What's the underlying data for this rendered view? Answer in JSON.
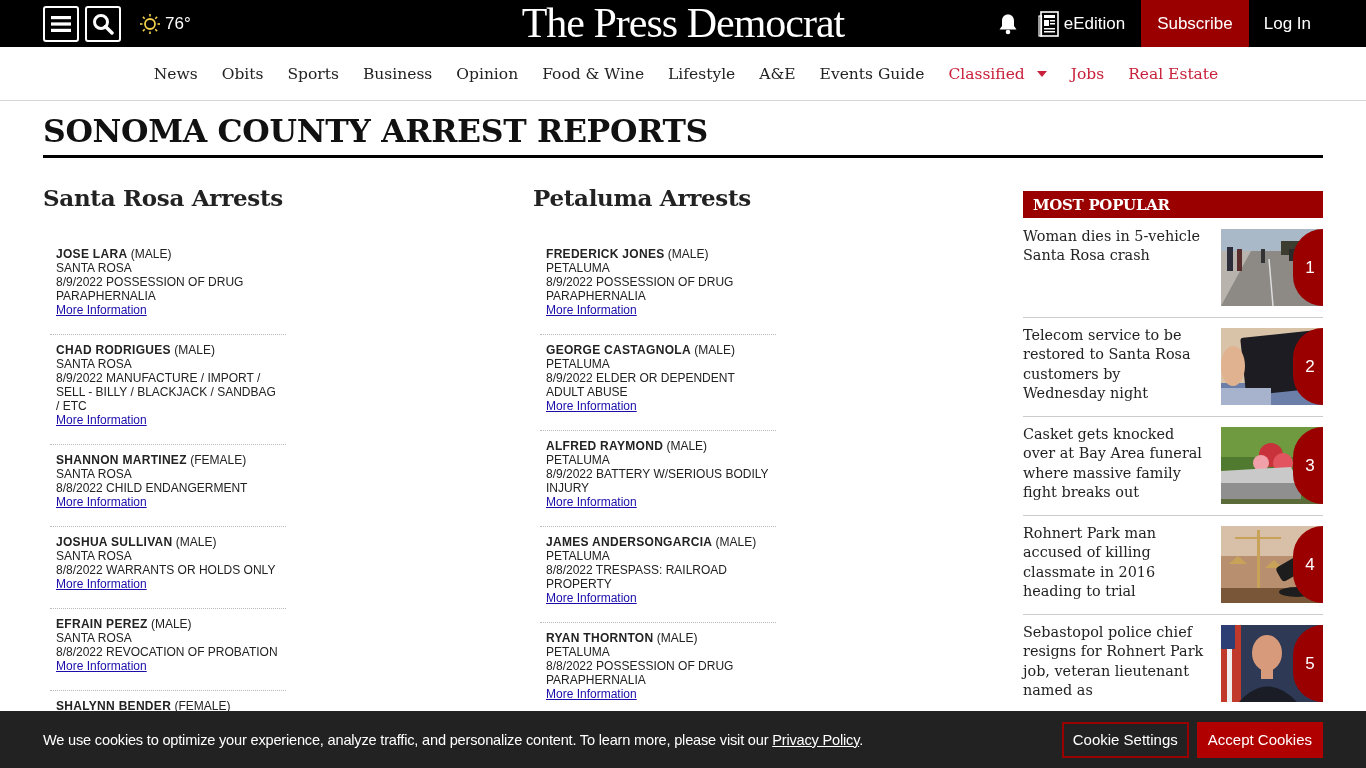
{
  "header": {
    "weather": "76°",
    "logo": "The Press Democrat",
    "edition": "eEdition",
    "subscribe": "Subscribe",
    "login": "Log In"
  },
  "nav": [
    {
      "label": "News",
      "kind": "section",
      "dropdown": false
    },
    {
      "label": "Obits",
      "kind": "section",
      "dropdown": false
    },
    {
      "label": "Sports",
      "kind": "section",
      "dropdown": false
    },
    {
      "label": "Business",
      "kind": "section",
      "dropdown": false
    },
    {
      "label": "Opinion",
      "kind": "section",
      "dropdown": false
    },
    {
      "label": "Food & Wine",
      "kind": "section",
      "dropdown": false
    },
    {
      "label": "Lifestyle",
      "kind": "section",
      "dropdown": false
    },
    {
      "label": "A&E",
      "kind": "section",
      "dropdown": false
    },
    {
      "label": "Events Guide",
      "kind": "section",
      "dropdown": false
    },
    {
      "label": "Classified",
      "kind": "promo",
      "dropdown": true
    },
    {
      "label": "Jobs",
      "kind": "promo",
      "dropdown": false
    },
    {
      "label": "Real Estate",
      "kind": "promo",
      "dropdown": false
    }
  ],
  "page_title": "SONOMA COUNTY ARREST REPORTS",
  "columns": [
    {
      "title": "Santa Rosa Arrests",
      "arrests": [
        {
          "name": "JOSE LARA",
          "gender": "(MALE)",
          "city": "SANTA ROSA",
          "charge": "8/9/2022 POSSESSION OF DRUG PARAPHERNALIA",
          "link": "More Information"
        },
        {
          "name": "CHAD RODRIGUES",
          "gender": "(MALE)",
          "city": "SANTA ROSA",
          "charge": "8/9/2022 MANUFACTURE / IMPORT / SELL - BILLY / BLACKJACK / SANDBAG / ETC",
          "link": "More Information"
        },
        {
          "name": "SHANNON MARTINEZ",
          "gender": "(FEMALE)",
          "city": "SANTA ROSA",
          "charge": "8/8/2022 CHILD ENDANGERMENT",
          "link": "More Information"
        },
        {
          "name": "JOSHUA SULLIVAN",
          "gender": "(MALE)",
          "city": "SANTA ROSA",
          "charge": "8/8/2022 WARRANTS OR HOLDS ONLY",
          "link": "More Information"
        },
        {
          "name": "EFRAIN PEREZ",
          "gender": "(MALE)",
          "city": "SANTA ROSA",
          "charge": "8/8/2022 REVOCATION OF PROBATION",
          "link": "More Information"
        },
        {
          "name": "SHALYNN BENDER",
          "gender": "(FEMALE)"
        }
      ]
    },
    {
      "title": "Petaluma Arrests",
      "arrests": [
        {
          "name": "FREDERICK JONES",
          "gender": "(MALE)",
          "city": "PETALUMA",
          "charge": "8/9/2022 POSSESSION OF DRUG PARAPHERNALIA",
          "link": "More Information"
        },
        {
          "name": "GEORGE CASTAGNOLA",
          "gender": "(MALE)",
          "city": "PETALUMA",
          "charge": "8/9/2022 ELDER OR DEPENDENT ADULT ABUSE",
          "link": "More Information"
        },
        {
          "name": "ALFRED RAYMOND",
          "gender": "(MALE)",
          "city": "PETALUMA",
          "charge": "8/9/2022 BATTERY W/SERIOUS BODILY INJURY",
          "link": "More Information"
        },
        {
          "name": "JAMES ANDERSONGARCIA",
          "gender": "(MALE)",
          "city": "PETALUMA",
          "charge": "8/8/2022 TRESPASS: RAILROAD PROPERTY",
          "link": "More Information"
        },
        {
          "name": "RYAN THORNTON",
          "gender": "(MALE)",
          "city": "PETALUMA",
          "charge": "8/8/2022 POSSESSION OF DRUG PARAPHERNALIA",
          "link": "More Information"
        }
      ]
    }
  ],
  "most_popular": {
    "title": "MOST POPULAR",
    "stories": [
      {
        "headline": "Woman dies in 5-vehicle Santa Rosa crash",
        "rank": "1"
      },
      {
        "headline": "Telecom service to be restored to Santa Rosa customers by Wednesday night",
        "rank": "2"
      },
      {
        "headline": "Casket gets knocked over at Bay Area funeral where massive family fight breaks out",
        "rank": "3"
      },
      {
        "headline": "Rohnert Park man accused of killing classmate in 2016 heading to trial",
        "rank": "4"
      },
      {
        "headline": "Sebastopol police chief resigns for Rohnert Park job, veteran lieutenant named as",
        "rank": "5"
      }
    ]
  },
  "cookie_banner": {
    "text": "We use cookies to optimize your experience, analyze traffic, and personalize content. To learn more, please visit our",
    "link": "Privacy Policy",
    "after": ".",
    "buttons": [
      {
        "label": "Cookie Settings",
        "kind": "outline"
      },
      {
        "label": "Accept Cookies",
        "kind": "primary"
      }
    ]
  }
}
